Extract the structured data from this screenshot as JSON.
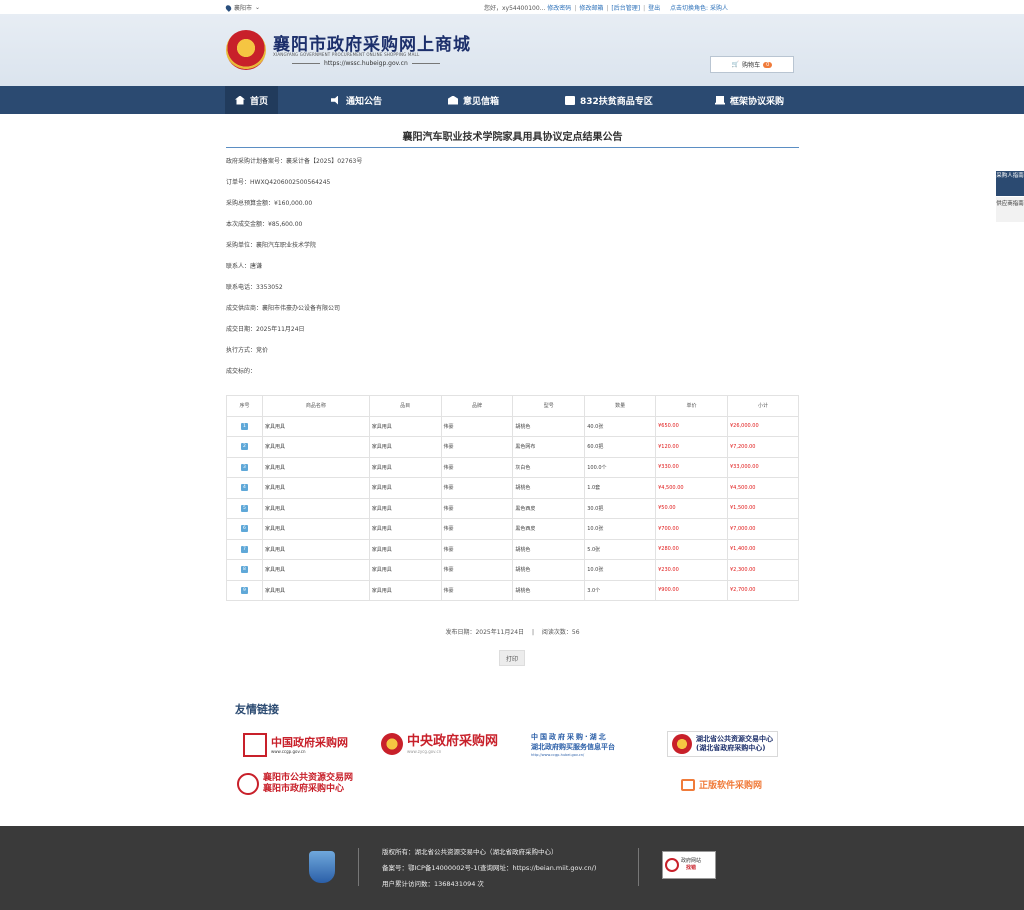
{
  "topbar": {
    "location": "襄阳市",
    "greeting": "您好，xy54400100...",
    "links": [
      "修改密码",
      "修改邮箱",
      "[后台管理]",
      "登出",
      "点击切换角色: 采购人"
    ]
  },
  "header": {
    "title": "襄阳市政府采购网上商城",
    "subtitle": "XIANGYANG GOVERNMENT PROCUREMENT ONLINE SHOPPING MALL",
    "url": "https://wssc.hubeigp.gov.cn",
    "cart_label": "购物车",
    "cart_count": "0"
  },
  "nav": {
    "items": [
      {
        "label": "首页",
        "icon": "home-icon"
      },
      {
        "label": "通知公告",
        "icon": "speaker-icon"
      },
      {
        "label": "意见信箱",
        "icon": "mailbox-icon"
      },
      {
        "label": "832扶贫商品专区",
        "icon": "envelope-icon"
      },
      {
        "label": "框架协议采购",
        "icon": "document-icon"
      }
    ]
  },
  "doc": {
    "title": "襄阳汽车职业技术学院家具用具协议定点结果公告",
    "fields": [
      "政府采购计划备案号：襄采计备【2025】02763号",
      "订单号：HWXQ4206002500564245",
      "采购总预算金额：¥160,000.00",
      "本次成交金额：¥85,600.00",
      "采购单位：襄阳汽车职业技术学院",
      "联系人：唐谦",
      "联系电话：3353052",
      "成交供应商：襄阳市伟豪办公设备有限公司",
      "成交日期：2025年11月24日",
      "执行方式：竞价",
      "成交标的："
    ]
  },
  "table": {
    "headers": [
      "序号",
      "商品名称",
      "品目",
      "品牌",
      "型号",
      "数量",
      "单价",
      "小计"
    ],
    "rows": [
      {
        "no": "1",
        "name": "家具用具",
        "category": "家具用具",
        "brand": "伟豪",
        "model": "胡桃色",
        "qty": "40.0张",
        "price": "¥650.00",
        "subtotal": "¥26,000.00"
      },
      {
        "no": "2",
        "name": "家具用具",
        "category": "家具用具",
        "brand": "伟豪",
        "model": "黑色网布",
        "qty": "60.0把",
        "price": "¥120.00",
        "subtotal": "¥7,200.00"
      },
      {
        "no": "3",
        "name": "家具用具",
        "category": "家具用具",
        "brand": "伟豪",
        "model": "灰白色",
        "qty": "100.0个",
        "price": "¥330.00",
        "subtotal": "¥33,000.00"
      },
      {
        "no": "4",
        "name": "家具用具",
        "category": "家具用具",
        "brand": "伟豪",
        "model": "胡桃色",
        "qty": "1.0套",
        "price": "¥4,500.00",
        "subtotal": "¥4,500.00"
      },
      {
        "no": "5",
        "name": "家具用具",
        "category": "家具用具",
        "brand": "伟豪",
        "model": "黑色西皮",
        "qty": "30.0把",
        "price": "¥50.00",
        "subtotal": "¥1,500.00"
      },
      {
        "no": "6",
        "name": "家具用具",
        "category": "家具用具",
        "brand": "伟豪",
        "model": "黑色西皮",
        "qty": "10.0张",
        "price": "¥700.00",
        "subtotal": "¥7,000.00"
      },
      {
        "no": "7",
        "name": "家具用具",
        "category": "家具用具",
        "brand": "伟豪",
        "model": "胡桃色",
        "qty": "5.0张",
        "price": "¥280.00",
        "subtotal": "¥1,400.00"
      },
      {
        "no": "8",
        "name": "家具用具",
        "category": "家具用具",
        "brand": "伟豪",
        "model": "胡桃色",
        "qty": "10.0张",
        "price": "¥230.00",
        "subtotal": "¥2,300.00"
      },
      {
        "no": "9",
        "name": "家具用具",
        "category": "家具用具",
        "brand": "伟豪",
        "model": "胡桃色",
        "qty": "3.0个",
        "price": "¥900.00",
        "subtotal": "¥2,700.00"
      }
    ]
  },
  "publish": {
    "date": "发布日期：2025年11月24日",
    "sep": "|",
    "views": "阅读次数：56",
    "print_label": "打印"
  },
  "side": {
    "buyer_guide": "采购人指南",
    "supplier_guide": "供应商指南"
  },
  "links": {
    "title": "友情链接",
    "ccgp": {
      "name": "中国政府采购网",
      "url": "www.ccgp.gov.cn"
    },
    "zycg": {
      "name": "中央政府采购网",
      "url": "www.zycg.gov.cn"
    },
    "hubei": {
      "line1": "中国政府采购·湖北",
      "line2": "湖北政府购买服务信息平台",
      "url": "http://www.ccgp-hubei.gov.cn/"
    },
    "hbggzy": {
      "line1": "湖北省公共资源交易中心",
      "line2": "(湖北省政府采购中心)"
    },
    "xyggzy": {
      "line1": "襄阳市公共资源交易网",
      "line2": "襄阳市政府采购中心"
    },
    "zbrj": {
      "name": "正版软件采购网"
    }
  },
  "footer": {
    "copyright": "版权所有：湖北省公共资源交易中心（湖北省政府采购中心）",
    "icp": "备案号：鄂ICP备14000002号-1(查询网址：https://beian.miit.gov.cn/)",
    "visits": "用户累计访问数：1368431094 次",
    "gov_badge_line1": "政府网站",
    "gov_badge_line2": "找错"
  }
}
